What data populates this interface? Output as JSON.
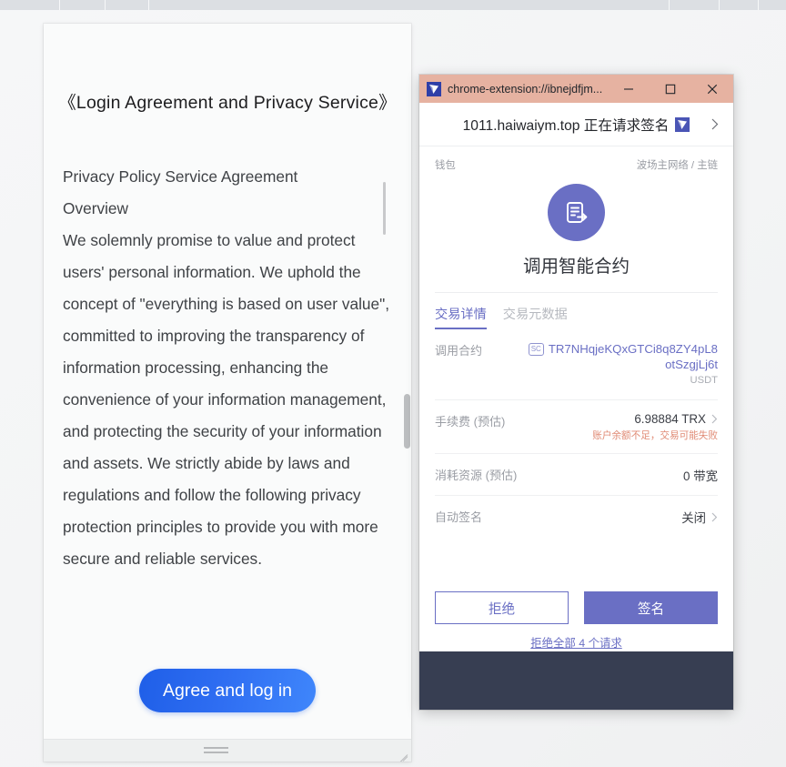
{
  "document_panel": {
    "title": "《Login Agreement and Privacy Service》",
    "heading": "Privacy Policy Service Agreement",
    "subheading": "Overview",
    "body": "We solemnly promise to value and protect users' personal information. We uphold the concept of \"everything is based on user value\", committed to improving the transparency of information processing, enhancing the convenience of your information management, and protecting the security of your information and assets. We strictly abide by laws and regulations and follow the following privacy protection principles to provide you with more secure and reliable services.",
    "agree_button": "Agree and log in",
    "drag_handle_icon": "drag-handle-icon",
    "resize_grip_icon": "resize-grip-icon"
  },
  "extension_window": {
    "titlebar": {
      "favicon_icon": "tronlink-logo-icon",
      "title": "chrome-extension://ibnejdfjm...",
      "minimize_icon": "minimize-icon",
      "maximize_icon": "maximize-icon",
      "close_icon": "close-icon",
      "background_color": "#e6b2a1"
    },
    "request_header": {
      "title": "1011.haiwaiym.top 正在请求签名",
      "badge_icon": "tronlink-badge-icon",
      "next_icon": "chevron-right-icon"
    },
    "wallet_row": {
      "label": "钱包",
      "network": "波场主网络 / 主链"
    },
    "action": {
      "icon": "smart-contract-icon",
      "title": "调用智能合约",
      "accent_color": "#6a6fc4"
    },
    "tabs": [
      {
        "label": "交易详情",
        "active": true
      },
      {
        "label": "交易元数据",
        "active": false
      }
    ],
    "details": [
      {
        "label": "调用合约",
        "chip": "SC",
        "address_line1": "TR7NHqjeKQxGTCi8q8ZY4pL8",
        "address_line2": "otSzgjLj6t",
        "token": "USDT"
      },
      {
        "label": "手续费 (预估)",
        "value": "6.98884 TRX",
        "warning": "账户余额不足，交易可能失败",
        "warning_color": "#e08a74",
        "chevron_icon": "chevron-right-icon"
      },
      {
        "label": "消耗资源 (预估)",
        "value": "0 带宽"
      },
      {
        "label": "自动签名",
        "value": "关闭",
        "chevron_icon": "chevron-right-icon"
      }
    ],
    "buttons": {
      "reject": "拒绝",
      "sign": "签名",
      "reject_all": "拒绝全部 4 个请求"
    }
  }
}
